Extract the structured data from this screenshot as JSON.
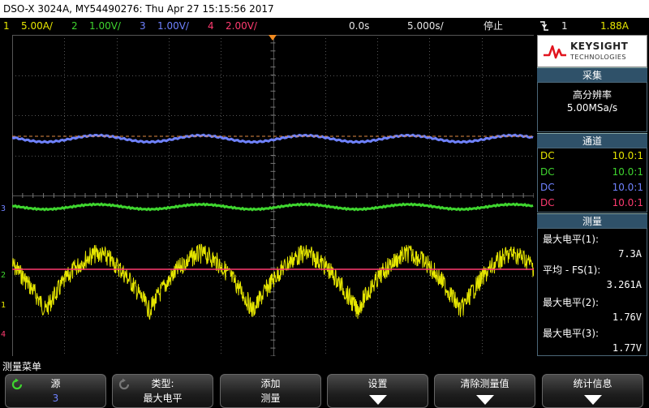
{
  "title_bar": "DSO-X 3024A, MY54490276: Thu Apr 27 15:15:56 2017",
  "status": {
    "ch1": {
      "num": "1",
      "scale": "5.00A/"
    },
    "ch2": {
      "num": "2",
      "scale": "1.00V/"
    },
    "ch3": {
      "num": "3",
      "scale": "1.00V/"
    },
    "ch4": {
      "num": "4",
      "scale": "2.00V/"
    },
    "delay": "0.0s",
    "timebase": "5.000s/",
    "run_state": "停止",
    "trigger_icon": "trigger-falling-edge-icon",
    "trigger_source": "1",
    "trigger_level": "1.88A"
  },
  "channel_markers": [
    "3",
    "2",
    "1",
    "4"
  ],
  "colors": {
    "ch1": "#e6e600",
    "ch2": "#3fd52f",
    "ch3": "#6f82ff",
    "ch4": "#ff3b70",
    "panel_header": "#2f5169"
  },
  "logo": {
    "brand": "KEYSIGHT",
    "sub": "TECHNOLOGIES",
    "icon": "keysight-wave-logo"
  },
  "acquisition": {
    "header": "采集",
    "mode": "高分辨率",
    "rate": "5.00MSa/s"
  },
  "channels": {
    "header": "通道",
    "rows": [
      {
        "coupling": "DC",
        "probe": "10.0:1"
      },
      {
        "coupling": "DC",
        "probe": "10.0:1"
      },
      {
        "coupling": "DC",
        "probe": "10.0:1"
      },
      {
        "coupling": "DC",
        "probe": "10.0:1"
      }
    ]
  },
  "measurements": {
    "header": "测量",
    "items": [
      {
        "label": "最大电平(1):",
        "value": "7.3A"
      },
      {
        "label": "平均 - FS(1):",
        "value": "3.261A"
      },
      {
        "label": "最大电平(2):",
        "value": "1.76V"
      },
      {
        "label": "最大电平(3):",
        "value": "1.77V"
      }
    ]
  },
  "menu_title": "测量菜单",
  "softkeys": [
    {
      "top": "源",
      "bottom": "3",
      "icon": "rotate-knob-icon"
    },
    {
      "top": "类型:",
      "bottom": "最大电平",
      "icon": "rotate-knob-icon"
    },
    {
      "top": "添加",
      "bottom": "测量"
    },
    {
      "top": "设置",
      "bottom": ""
    },
    {
      "top": "清除测量值",
      "bottom": ""
    },
    {
      "top": "统计信息",
      "bottom": ""
    }
  ]
}
